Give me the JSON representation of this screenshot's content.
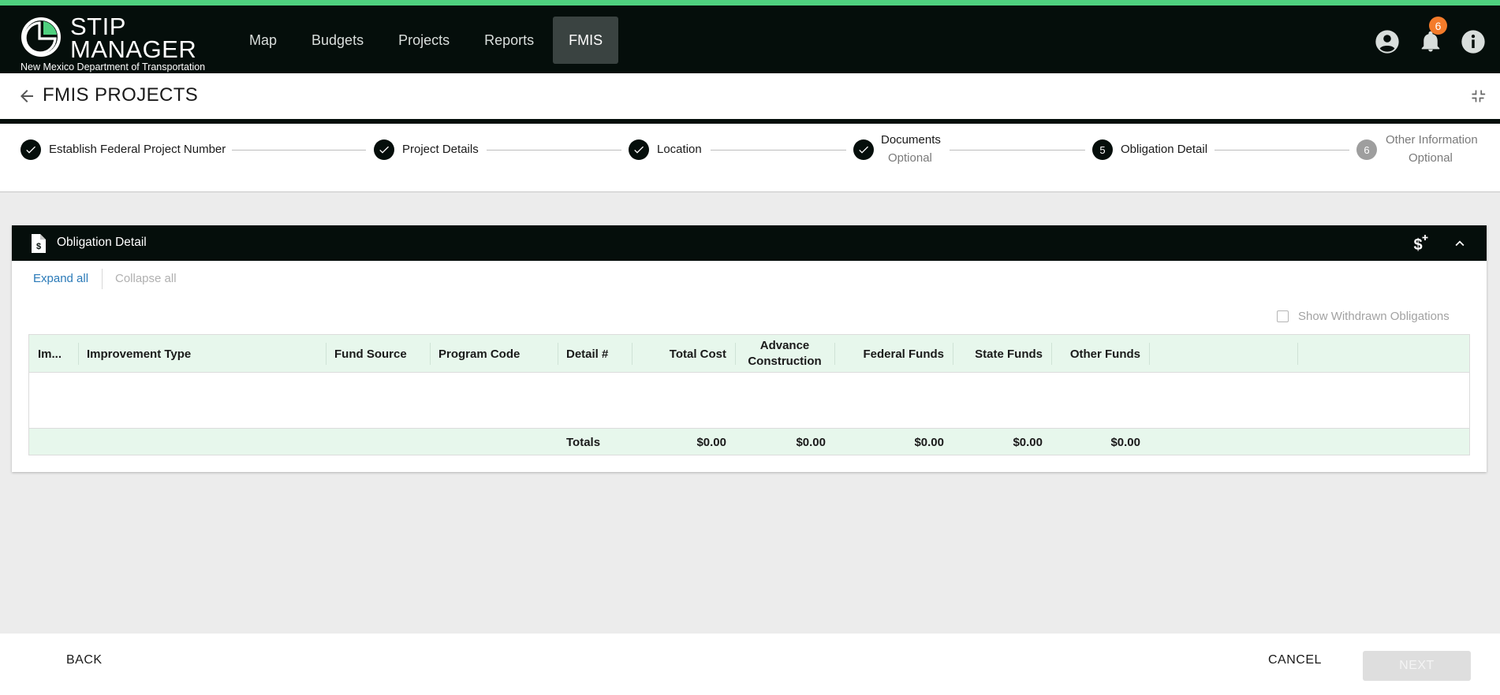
{
  "brand": {
    "line1": "STIP",
    "line2": "MANAGER",
    "department": "New Mexico Department of Transportation",
    "accent_color": "#4fd07f",
    "dark_color": "#050e0b"
  },
  "nav": {
    "items": [
      {
        "label": "Map"
      },
      {
        "label": "Budgets"
      },
      {
        "label": "Projects"
      },
      {
        "label": "Reports"
      },
      {
        "label": "FMIS",
        "active": true
      }
    ]
  },
  "header_icons": {
    "account": "account-circle-icon",
    "notifications": "bell-icon",
    "notification_count": "6",
    "info": "info-icon"
  },
  "page": {
    "title": "FMIS PROJECTS"
  },
  "stepper": {
    "steps": [
      {
        "label": "Establish Federal Project Number",
        "status": "complete"
      },
      {
        "label": "Project Details",
        "status": "complete"
      },
      {
        "label": "Location",
        "status": "complete"
      },
      {
        "label": "Documents",
        "sublabel": "Optional",
        "status": "complete"
      },
      {
        "label": "Obligation Detail",
        "number": "5",
        "status": "current"
      },
      {
        "label": "Other Information",
        "sublabel": "Optional",
        "number": "6",
        "status": "pending"
      }
    ]
  },
  "card": {
    "title": "Obligation Detail",
    "expand_all": "Expand all",
    "collapse_all": "Collapse all",
    "show_withdrawn": "Show Withdrawn Obligations",
    "show_withdrawn_checked": false
  },
  "table": {
    "columns": [
      "Im...",
      "Improvement Type",
      "Fund Source",
      "Program Code",
      "Detail #",
      "Total Cost",
      "Advance Construction",
      "Federal Funds",
      "State Funds",
      "Other Funds"
    ],
    "rows": [],
    "totals": {
      "label": "Totals",
      "total_cost": "$0.00",
      "advance_construction": "$0.00",
      "federal_funds": "$0.00",
      "state_funds": "$0.00",
      "other_funds": "$0.00"
    }
  },
  "footer": {
    "back": "BACK",
    "cancel": "CANCEL",
    "next": "NEXT"
  }
}
